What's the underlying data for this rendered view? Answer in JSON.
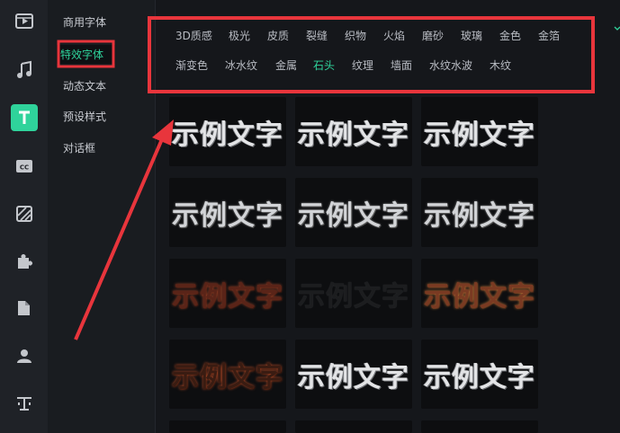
{
  "rail": {
    "icons": [
      "clapper-icon",
      "music-icon",
      "text-icon",
      "caption-icon",
      "filter-icon",
      "puzzle-icon",
      "folder-icon",
      "avatar-icon",
      "text-template-icon"
    ],
    "active_icon": "text-icon",
    "accent": "#2fd39b"
  },
  "categories": [
    "商用字体",
    "特效字体",
    "动态文本",
    "预设样式",
    "对话框"
  ],
  "active_category": "特效字体",
  "tags": {
    "row1": [
      "3D质感",
      "极光",
      "皮质",
      "裂缝",
      "织物",
      "火焰",
      "磨砂",
      "玻璃",
      "金色",
      "金箔"
    ],
    "row2": [
      "渐变色",
      "冰水纹",
      "金属",
      "石头",
      "纹理",
      "墙面",
      "水纹水波",
      "木纹"
    ],
    "active": "石头"
  },
  "sample_text": "示例文字",
  "annotation_color": "#e8353c"
}
